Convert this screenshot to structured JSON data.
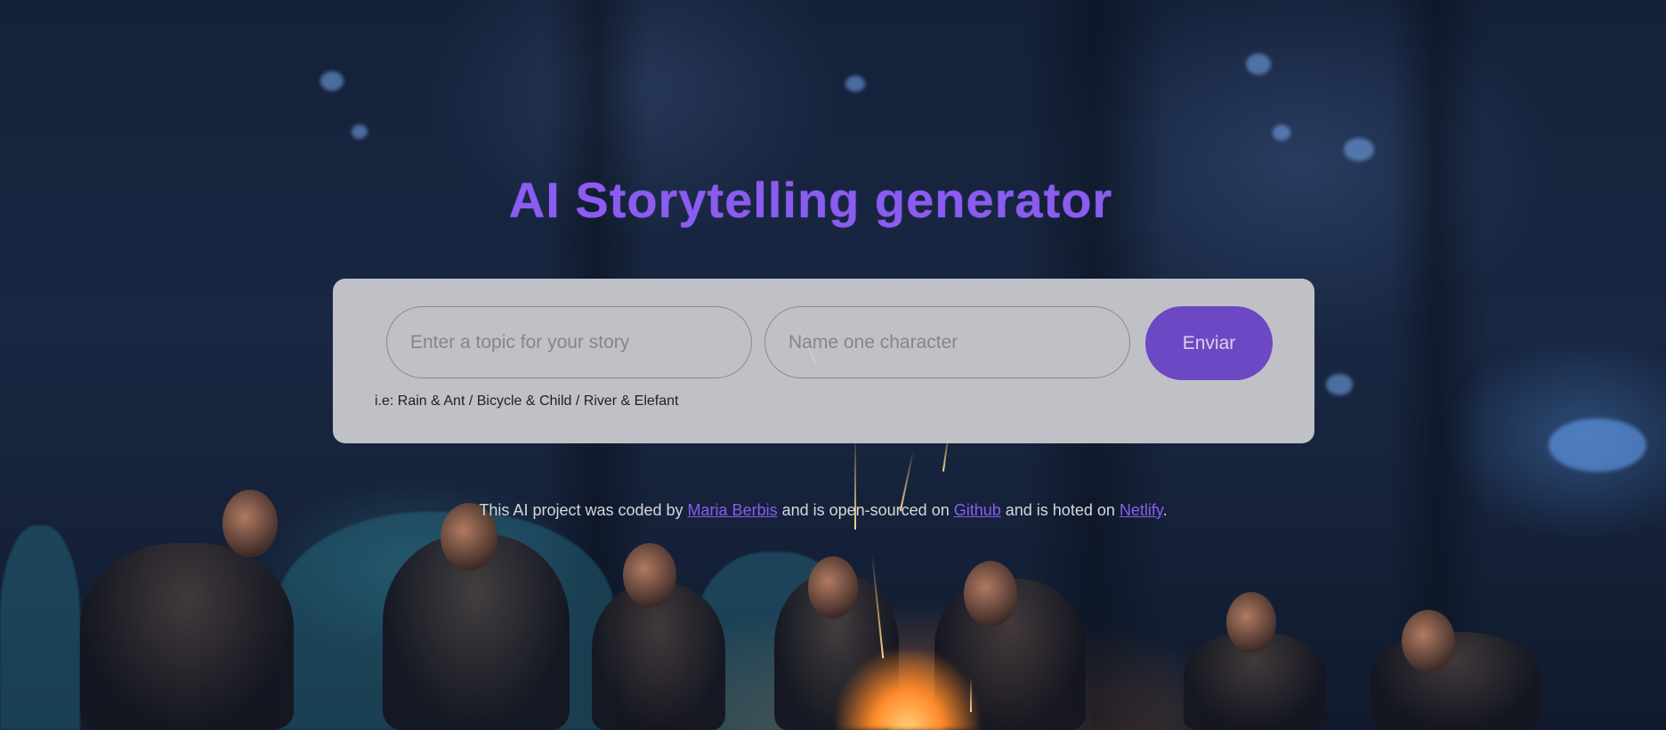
{
  "page": {
    "title": "AI Storytelling generator"
  },
  "form": {
    "topic_placeholder": "Enter a topic for your story",
    "topic_value": "",
    "character_placeholder": "Name one character",
    "character_value": "",
    "submit_label": "Enviar",
    "hint": "i.e: Rain & Ant / Bicycle & Child / River & Elefant"
  },
  "footer": {
    "text_1": "This AI project was coded by ",
    "author_link": "Maria Berbis",
    "text_2": " and is open-sourced on ",
    "github_link": "Github",
    "text_3": " and is hoted on ",
    "netlify_link": "Netlify",
    "text_4": "."
  },
  "colors": {
    "accent": "#8a5cf0",
    "button": "#6d48c4",
    "card": "#cdcdd2"
  },
  "background": {
    "image": "campfire-forest-night-photo"
  }
}
